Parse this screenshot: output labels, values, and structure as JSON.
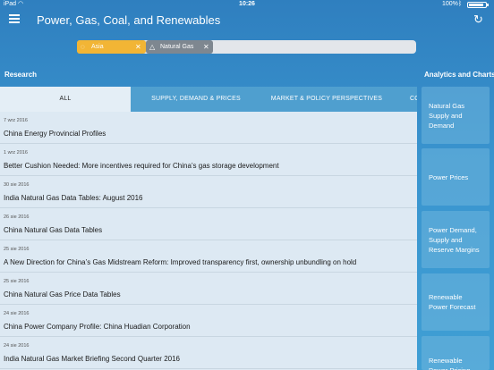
{
  "status": {
    "carrier": "iPad",
    "time": "10:26",
    "battery": "100%"
  },
  "header": {
    "title": "Power, Gas, Coal, and Renewables"
  },
  "filters": [
    {
      "label": "Asia",
      "icon": "globe-icon",
      "color": "#f2b535"
    },
    {
      "label": "Natural Gas",
      "icon": "warning-icon",
      "color": "#7e8790"
    }
  ],
  "research": {
    "label": "Research",
    "tabs": [
      "ALL",
      "SUPPLY, DEMAND & PRICES",
      "MARKET & POLICY PERSPECTIVES",
      "CO"
    ],
    "items": [
      {
        "date": "7 wrz 2016",
        "title": "China Energy Provincial Profiles"
      },
      {
        "date": "1 wrz 2016",
        "title": "Better Cushion Needed: More incentives required for China’s gas storage development"
      },
      {
        "date": "30 sie 2016",
        "title": "India Natural Gas Data Tables: August 2016"
      },
      {
        "date": "26 sie 2016",
        "title": "China Natural Gas Data Tables"
      },
      {
        "date": "25 sie 2016",
        "title": "A New Direction for China’s Gas Midstream Reform: Improved transparency first, ownership unbundling on hold"
      },
      {
        "date": "25 sie 2016",
        "title": "China Natural Gas Price Data Tables"
      },
      {
        "date": "24 sie 2016",
        "title": "China Power Company Profile: China Huadian Corporation"
      },
      {
        "date": "24 sie 2016",
        "title": "India Natural Gas Market Briefing Second Quarter 2016"
      }
    ]
  },
  "analytics": {
    "label": "Analytics and Charts",
    "cards": [
      "Natural Gas Supply and Demand",
      "Power Prices",
      "Power Demand, Supply and Reserve Margins",
      "Renewable Power Forecast",
      "Renewable Power Pricing"
    ]
  }
}
